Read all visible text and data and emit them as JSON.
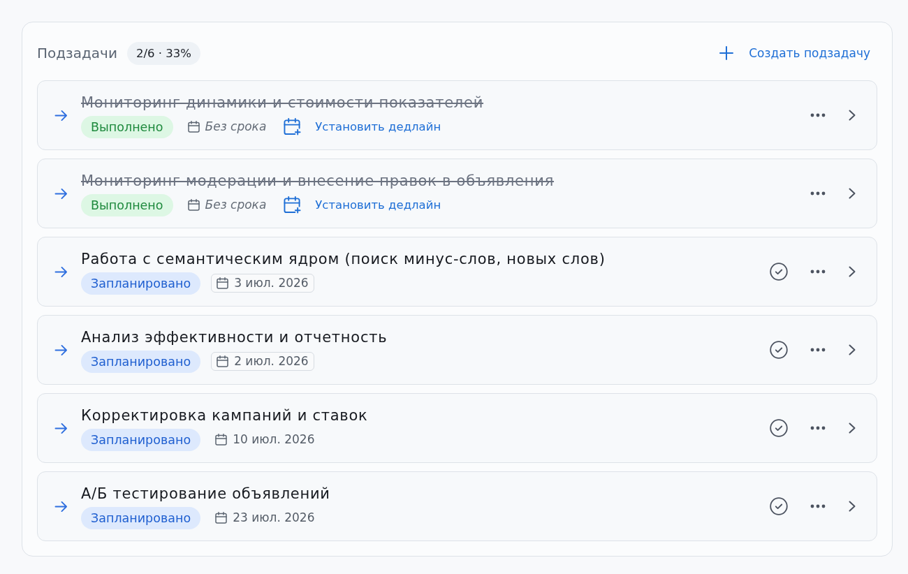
{
  "header": {
    "title": "Подзадачи",
    "progress": "2/6 · 33%",
    "create_button": "Создать подзадачу"
  },
  "subtasks": [
    {
      "title": "Мониторинг динамики и стоимости показателей",
      "done": true,
      "status": {
        "label": "Выполнено",
        "kind": "done"
      },
      "due": {
        "label": "Без срока",
        "kind": "unset"
      },
      "deadline_action": "Установить дедлайн"
    },
    {
      "title": "Мониторинг модерации и внесение правок в объявления",
      "done": true,
      "status": {
        "label": "Выполнено",
        "kind": "done"
      },
      "due": {
        "label": "Без срока",
        "kind": "unset"
      },
      "deadline_action": "Установить дедлайн"
    },
    {
      "title": "Работа с семантическим ядром (поиск минус-слов, новых слов)",
      "done": false,
      "status": {
        "label": "Запланировано",
        "kind": "planned"
      },
      "due": {
        "label": "3 июл. 2026",
        "kind": "chip"
      }
    },
    {
      "title": "Анализ эффективности и отчетность",
      "done": false,
      "status": {
        "label": "Запланировано",
        "kind": "planned"
      },
      "due": {
        "label": "2 июл. 2026",
        "kind": "chip"
      }
    },
    {
      "title": "Корректировка кампаний и ставок",
      "done": false,
      "status": {
        "label": "Запланировано",
        "kind": "planned"
      },
      "due": {
        "label": "10 июл. 2026",
        "kind": "plain"
      }
    },
    {
      "title": "А/Б тестирование объявлений",
      "done": false,
      "status": {
        "label": "Запланировано",
        "kind": "planned"
      },
      "due": {
        "label": "23 июл. 2026",
        "kind": "plain"
      }
    }
  ]
}
